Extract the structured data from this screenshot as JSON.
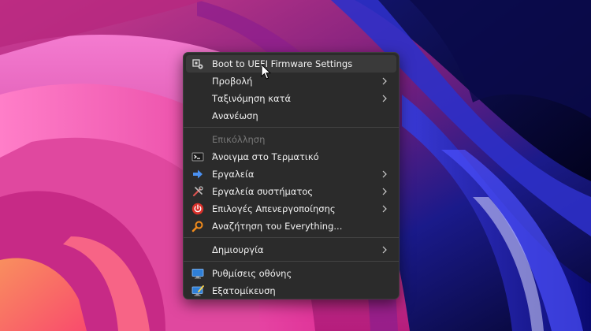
{
  "menu": {
    "items": [
      {
        "label": "Boot to UEFI Firmware Settings"
      },
      {
        "label": "Προβολή"
      },
      {
        "label": "Ταξινόμηση κατά"
      },
      {
        "label": "Ανανέωση"
      },
      {
        "label": "Επικόλληση"
      },
      {
        "label": "Άνοιγμα στο Τερματικό"
      },
      {
        "label": "Εργαλεία"
      },
      {
        "label": "Εργαλεία συστήματος"
      },
      {
        "label": "Επιλογές Απενεργοποίησης"
      },
      {
        "label": "Αναζήτηση του Everything..."
      },
      {
        "label": "Δημιουργία"
      },
      {
        "label": "Ρυθμίσεις οθόνης"
      },
      {
        "label": "Εξατομίκευση"
      }
    ]
  },
  "icons": {
    "uefi": "gear-cpu-icon",
    "terminal": "terminal-icon",
    "tools": "arrow-right-icon",
    "system_tools": "wrench-screwdriver-icon",
    "shutdown": "power-icon",
    "everything": "magnifier-icon",
    "display": "monitor-icon",
    "personalize": "monitor-brush-icon"
  },
  "colors": {
    "menu_bg": "#2b2b2b",
    "hover_bg": "#3a3a3a",
    "text": "#f2f2f2",
    "disabled_text": "#7a7a7a"
  }
}
